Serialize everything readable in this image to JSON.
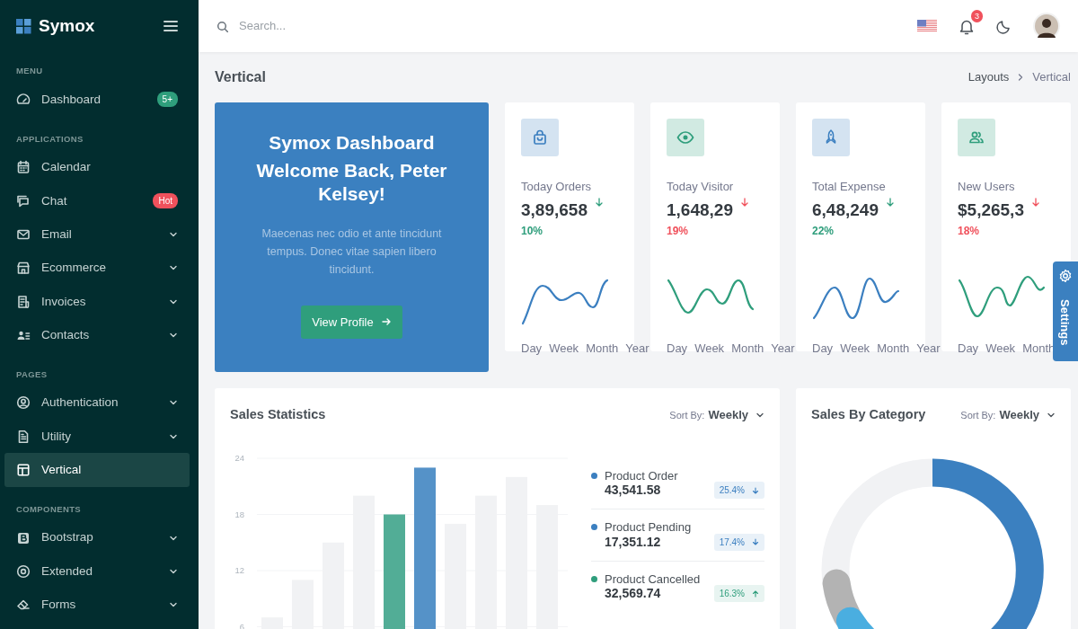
{
  "brand": {
    "name": "Symox"
  },
  "sidebar": {
    "sections": [
      {
        "title": "MENU",
        "items": [
          {
            "label": "Dashboard",
            "badge": {
              "text": "5+",
              "color": "#2f9e7c"
            },
            "has_submenu": false,
            "selected": false
          }
        ]
      },
      {
        "title": "APPLICATIONS",
        "items": [
          {
            "label": "Calendar",
            "has_submenu": false,
            "selected": false
          },
          {
            "label": "Chat",
            "badge": {
              "text": "Hot",
              "color": "#f0515c"
            },
            "has_submenu": false,
            "selected": false
          },
          {
            "label": "Email",
            "has_submenu": true,
            "selected": false
          },
          {
            "label": "Ecommerce",
            "has_submenu": true,
            "selected": false
          },
          {
            "label": "Invoices",
            "has_submenu": true,
            "selected": false
          },
          {
            "label": "Contacts",
            "has_submenu": true,
            "selected": false
          }
        ]
      },
      {
        "title": "PAGES",
        "items": [
          {
            "label": "Authentication",
            "has_submenu": true,
            "selected": false
          },
          {
            "label": "Utility",
            "has_submenu": true,
            "selected": false
          },
          {
            "label": "Vertical",
            "has_submenu": false,
            "selected": true
          }
        ]
      },
      {
        "title": "COMPONENTS",
        "items": [
          {
            "label": "Bootstrap",
            "has_submenu": true,
            "selected": false
          },
          {
            "label": "Extended",
            "has_submenu": true,
            "selected": false
          },
          {
            "label": "Forms",
            "has_submenu": true,
            "selected": false
          }
        ]
      }
    ]
  },
  "topbar": {
    "search": {
      "placeholder": "Search..."
    },
    "notifications": "3"
  },
  "page": {
    "title": "Vertical",
    "breadcrumb": [
      "Layouts",
      "Vertical"
    ]
  },
  "welcome": {
    "title": "Symox Dashboard",
    "subtitle": "Welcome Back, Peter Kelsey!",
    "text": "Maecenas nec odio et ante tincidunt tempus. Donec vitae sapien libero tincidunt.",
    "button": "View Profile"
  },
  "stats": [
    {
      "label": "Today Orders",
      "value": "3,89,658",
      "change": "10%",
      "positive": true,
      "color": "#3b7fc0",
      "periods": [
        "Day",
        "Week",
        "Month",
        "Year"
      ]
    },
    {
      "label": "Today Visitor",
      "value": "1,648,29",
      "change": "19%",
      "positive": false,
      "color": "#2f9e7c",
      "periods": [
        "Day",
        "Week",
        "Month",
        "Year"
      ]
    },
    {
      "label": "Total Expense",
      "value": "6,48,249",
      "change": "22%",
      "positive": true,
      "color": "#3b7fc0",
      "periods": [
        "Day",
        "Week",
        "Month",
        "Year"
      ]
    },
    {
      "label": "New Users",
      "value": "$5,265,3",
      "change": "18%",
      "positive": false,
      "color": "#2f9e7c",
      "periods": [
        "Day",
        "Week",
        "Month"
      ]
    }
  ],
  "sales_statistics": {
    "title": "Sales Statistics",
    "sort_label": "Sort By:",
    "sort_value": "Weekly",
    "chart_data": {
      "type": "bar",
      "values": [
        7,
        11,
        15,
        20,
        18,
        23,
        17,
        20,
        22,
        19
      ],
      "yticks": [
        6,
        12,
        18,
        24
      ],
      "ylim": [
        0,
        24
      ],
      "grid": true
    },
    "bars": [
      {
        "color": "#f1f2f4"
      },
      {
        "color": "#f1f2f4"
      },
      {
        "color": "#f1f2f4"
      },
      {
        "color": "#f1f2f4"
      },
      {
        "color": "#52ad96"
      },
      {
        "color": "#5592c8"
      },
      {
        "color": "#f1f2f4"
      },
      {
        "color": "#f1f2f4"
      },
      {
        "color": "#f1f2f4"
      },
      {
        "color": "#f1f2f4"
      }
    ],
    "legend": [
      {
        "label": "Product Order",
        "value": "43,541.58",
        "change": "25.4%",
        "up": false,
        "color": "#3b7fc0"
      },
      {
        "label": "Product Pending",
        "value": "17,351.12",
        "change": "17.4%",
        "up": false,
        "color": "#3b7fc0"
      },
      {
        "label": "Product Cancelled",
        "value": "32,569.74",
        "change": "16.3%",
        "up": true,
        "color": "#2f9e7c"
      }
    ]
  },
  "sales_by_category": {
    "title": "Sales By Category",
    "sort_label": "Sort By:",
    "sort_value": "Weekly"
  },
  "settings_tab": {
    "label": "Settings"
  }
}
